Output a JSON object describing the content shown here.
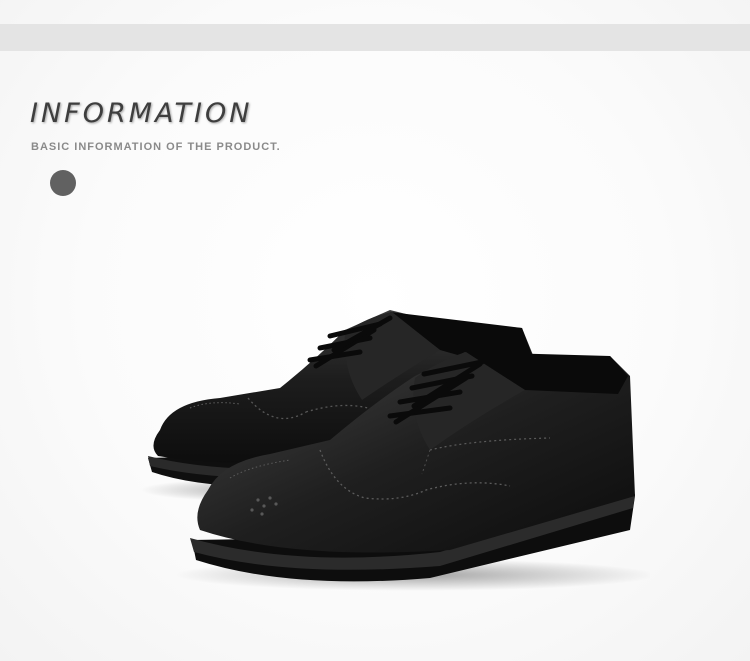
{
  "header": {
    "title": "INFORMATION",
    "subtitle": "BASIC INFORMATION OF THE PRODUCT."
  },
  "product": {
    "image_icon": "black-brogue-oxford-shoes-photo",
    "colors": {
      "leather": "#1b1b1b",
      "sole": "#101010",
      "accent_dot": "#616161",
      "band": "#e4e4e4"
    }
  }
}
